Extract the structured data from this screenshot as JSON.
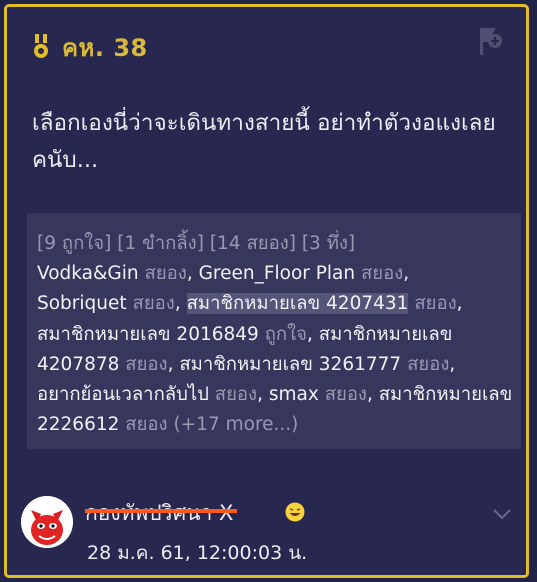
{
  "comment": {
    "id_label": "คห. 38",
    "text": "เลือกเองนี่ว่าจะเดินทางสายนี้ อย่าทำตัวงอแงเลยคนับ...",
    "medal_icon": "medal-icon",
    "flag_icon": "flag-add-icon"
  },
  "reactions": {
    "summary": "[9 ถูกใจ] [1 ขำกลิ้ง] [14 สยอง] [3 ทึ่ง]",
    "entries": [
      {
        "user": "Vodka&Gin",
        "reaction": "สยอง"
      },
      {
        "user": "Green_Floor Plan",
        "reaction": "สยอง"
      },
      {
        "user": "Sobriquet",
        "reaction": "สยอง"
      },
      {
        "user": "สมาชิกหมายเลข 4207431",
        "reaction": "สยอง"
      },
      {
        "user": "สมาชิกหมายเลข 2016849",
        "reaction": "ถูกใจ"
      },
      {
        "user": "สมาชิกหมายเลข 4207878",
        "reaction": "สยอง"
      },
      {
        "user": "สมาชิกหมายเลข 3261777",
        "reaction": "สยอง"
      },
      {
        "user": "อยากย้อนเวลากลับไป",
        "reaction": "สยอง"
      },
      {
        "user": "smax",
        "reaction": "สยอง"
      },
      {
        "user": "สมาชิกหมายเลข 2226612",
        "reaction": "สยอง"
      }
    ],
    "more": "(+17 more...)"
  },
  "author": {
    "name": "กองทัพปริศนา X",
    "timestamp": "28 ม.ค. 61, 12:00:03 น.",
    "avatar_icon": "red-devil-avatar",
    "emoji_icon": "laughing-emoji-icon"
  },
  "colors": {
    "accent_gold": "#e0be2a",
    "background": "#28274f",
    "strike": "#ff5a1e"
  }
}
